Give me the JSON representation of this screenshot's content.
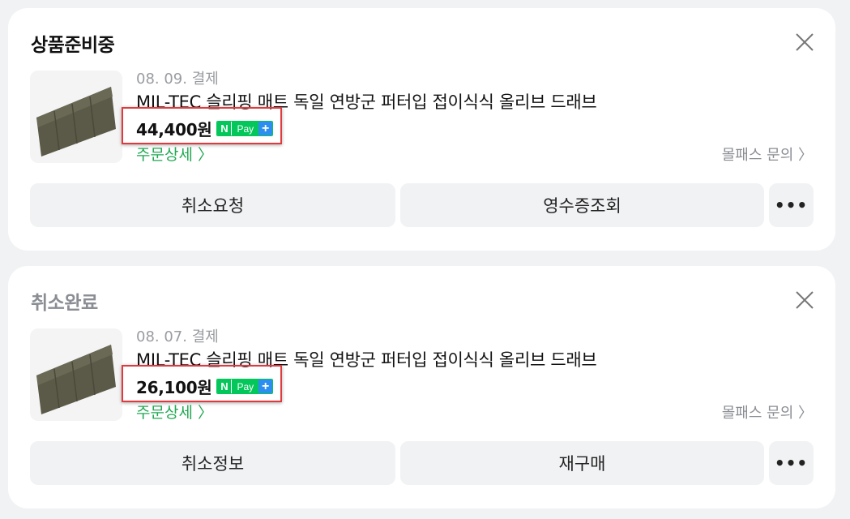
{
  "orders": [
    {
      "status": "상품준비중",
      "date": "08. 09. 결제",
      "product_name": "MIL-TEC 슬리핑 매트 독일 연방군 퍼터입 접이식식 올리브 드래브",
      "price": "44,400원",
      "npay_label": "Pay",
      "detail_link": "주문상세 〉",
      "inquiry_link": "몰패스 문의 〉",
      "buttons": [
        "취소요청",
        "영수증조회"
      ],
      "more_label": "•••"
    },
    {
      "status": "취소완료",
      "date": "08. 07. 결제",
      "product_name": "MIL-TEC 슬리핑 매트 독일 연방군 퍼터입 접이식식 올리브 드래브",
      "price": "26,100원",
      "npay_label": "Pay",
      "detail_link": "주문상세 〉",
      "inquiry_link": "몰패스 문의 〉",
      "buttons": [
        "취소정보",
        "재구매"
      ],
      "more_label": "•••"
    }
  ],
  "colors": {
    "background": "#f1f2f4",
    "detail_link": "#22a853",
    "npay_green": "#03c75a",
    "npay_plus": "#2b8ef0",
    "highlight": "#e0393e"
  }
}
